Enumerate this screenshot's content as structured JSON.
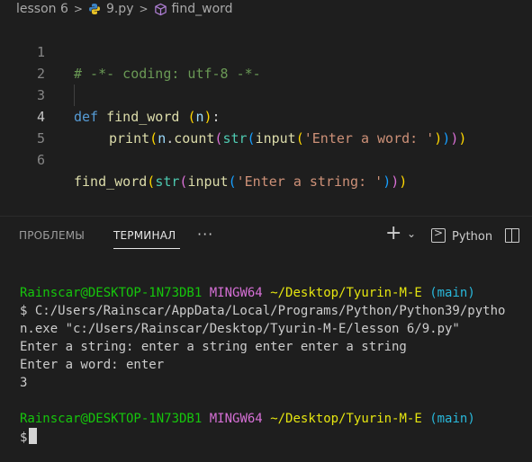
{
  "breadcrumb": {
    "folder": "lesson 6",
    "file": "9.py",
    "symbol": "find_word"
  },
  "editor": {
    "line_numbers": [
      "1",
      "2",
      "3",
      "4",
      "5",
      "6"
    ],
    "active_line": "4",
    "line1": "# -*- coding: utf-8 -*-",
    "line3": {
      "kw": "def",
      "name": "find_word",
      "open": "(",
      "param": "n",
      "close": ")",
      "colon": ":"
    },
    "line4": {
      "print": "print",
      "p1o": "(",
      "n": "n",
      "dot": ".",
      "count": "count",
      "p2o": "(",
      "str": "str",
      "p3o": "(",
      "input": "input",
      "p4o": "(",
      "s": "'Enter a word: '",
      "p4c": ")",
      "p3c": ")",
      "p2c": ")",
      "p1c": ")"
    },
    "line6": {
      "find_word": "find_word",
      "p1o": "(",
      "str": "str",
      "p2o": "(",
      "input": "input",
      "p3o": "(",
      "s": "'Enter a string: '",
      "p3c": ")",
      "p2c": ")",
      "p1c": ")"
    }
  },
  "panel": {
    "tabs": [
      "ПРОБЛЕМЫ",
      "ТЕРМИНАЛ"
    ],
    "active_tab": "ТЕРМИНАЛ",
    "more": "···",
    "new_terminal": "+",
    "terminal_profile": "Python"
  },
  "terminal": {
    "prompt_user": "Rainscar@DESKTOP-1N73DB1",
    "prompt_env": "MINGW64",
    "prompt_path": "~/Desktop/Tyurin-M-E",
    "prompt_branch": "(main)",
    "command": "$ C:/Users/Rainscar/AppData/Local/Programs/Python/Python39/pytho",
    "command_cont": "n.exe \"c:/Users/Rainscar/Desktop/Tyurin-M-E/lesson 6/9.py\"",
    "out1": "Enter a string: enter a string enter enter a string",
    "out2": "Enter a word: enter",
    "out3": "3",
    "prompt2_user": "Rainscar@DESKTOP-1N73DB1",
    "prompt2_env": "MINGW64",
    "prompt2_path": "~/Desktop/Tyurin-M-E",
    "prompt2_branch": "(main)",
    "dollar": "$"
  },
  "colors": {
    "background": "#1e1e1e",
    "prompt_user": "#16c60c",
    "prompt_env": "#d670d6",
    "prompt_path": "#e5e510",
    "prompt_branch": "#29b8db"
  }
}
